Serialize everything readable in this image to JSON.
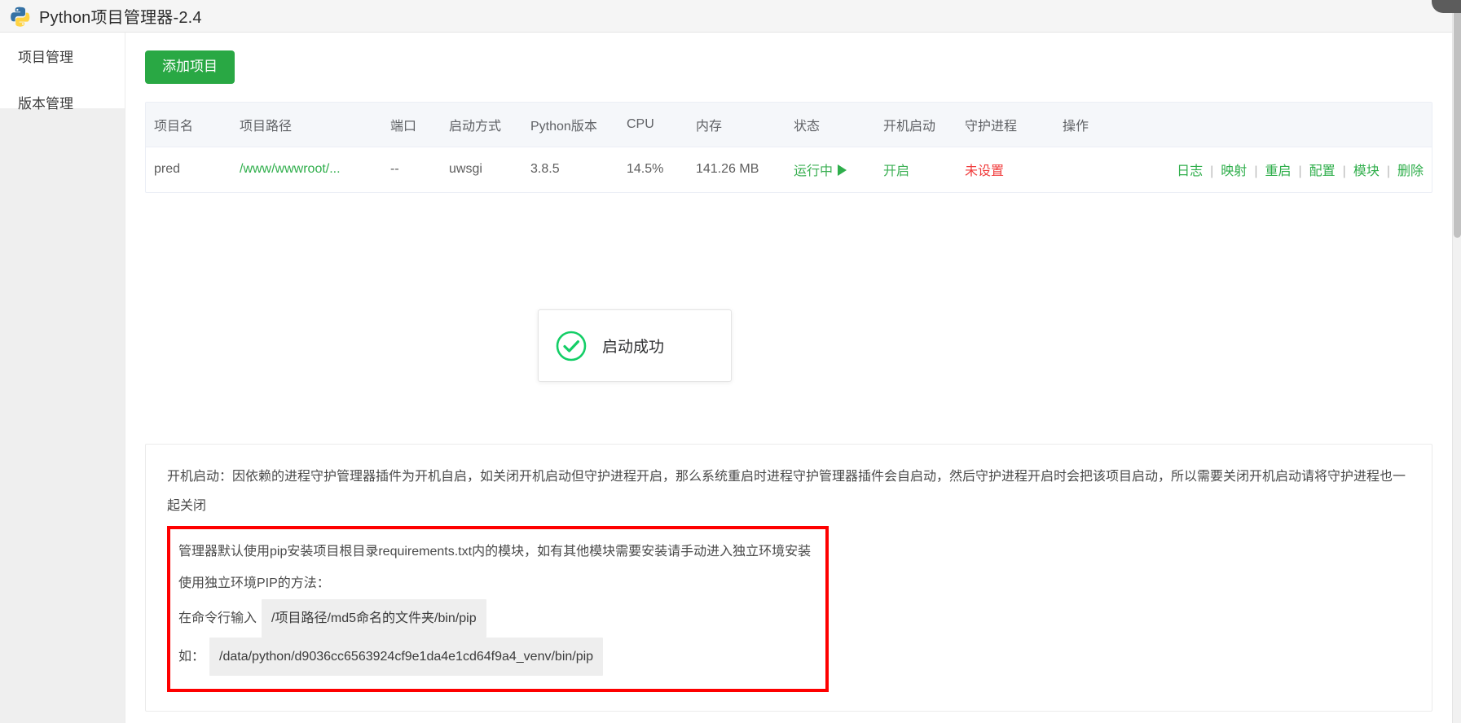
{
  "window": {
    "title": "Python项目管理器-2.4",
    "logo_icon": "python-logo-icon"
  },
  "sidebar": {
    "items": [
      {
        "label": "项目管理",
        "active": true
      },
      {
        "label": "版本管理",
        "active": false
      }
    ]
  },
  "toolbar": {
    "add_project_label": "添加项目",
    "accent_color": "#29a844"
  },
  "table": {
    "headers": {
      "name": "项目名",
      "path": "项目路径",
      "port": "端口",
      "mode": "启动方式",
      "pyver": "Python版本",
      "cpu": "CPU",
      "mem": "内存",
      "state": "状态",
      "boot": "开机启动",
      "guard": "守护进程",
      "ops": "操作"
    },
    "rows": [
      {
        "name": "pred",
        "path": "/www/wwwroot/...",
        "port": "--",
        "mode": "uwsgi",
        "pyver": "3.8.5",
        "cpu": "14.5%",
        "mem": "141.26 MB",
        "state": "运行中",
        "state_icon": "play-triangle-icon",
        "state_color": "#3cb054",
        "boot": "开启",
        "boot_color": "#3cb054",
        "guard": "未设置",
        "guard_color": "#f03c3c",
        "ops": [
          "日志",
          "映射",
          "重启",
          "配置",
          "模块",
          "删除"
        ]
      }
    ]
  },
  "toast": {
    "icon": "check-circle-icon",
    "icon_color": "#13ce66",
    "message": "启动成功"
  },
  "notes": {
    "boot_note": "开机启动：因依赖的进程守护管理器插件为开机自启，如关闭开机启动但守护进程开启，那么系统重启时进程守护管理器插件会自启动，然后守护进程开启时会把该项目启动，所以需要关闭开机启动请将守护进程也一起关闭",
    "pip_note": "管理器默认使用pip安装项目根目录requirements.txt内的模块，如有其他模块需要安装请手动进入独立环境安装",
    "pip_method_title": "使用独立环境PIP的方法：",
    "cmd_label": "在命令行输入",
    "cmd_value": "/项目路径/md5命名的文件夹/bin/pip",
    "example_label": "如：",
    "example_value": "/data/python/d9036cc6563924cf9e1da4e1cd64f9a4_venv/bin/pip",
    "highlight_border_color": "#fe0000"
  }
}
